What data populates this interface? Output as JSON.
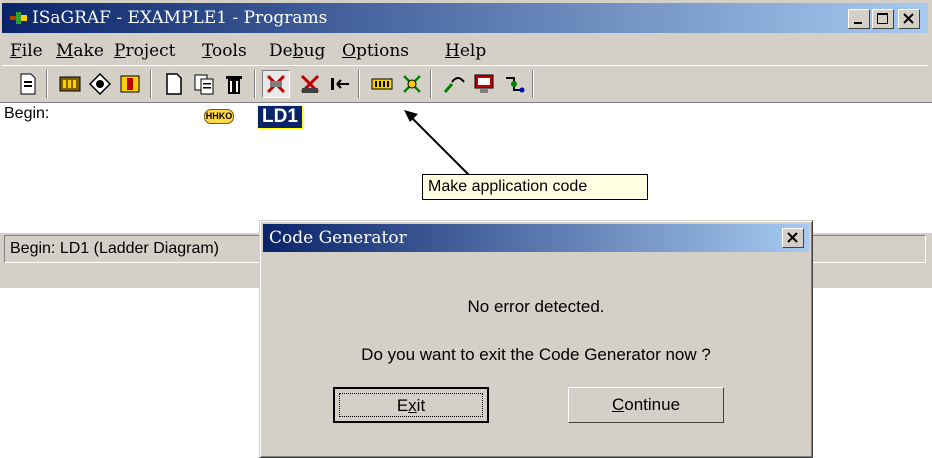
{
  "window": {
    "title": "ISaGRAF - EXAMPLE1 - Programs"
  },
  "menu": {
    "items": [
      {
        "label": "File",
        "accel": "F",
        "rest": "ile"
      },
      {
        "label": "Make",
        "accel": "M",
        "rest": "ake"
      },
      {
        "label": "Project",
        "accel": "P",
        "rest": "roject"
      },
      {
        "label": "Tools",
        "accel": "T",
        "rest": "ools"
      },
      {
        "label": "Debug",
        "pre": "De",
        "accel": "b",
        "rest": "ug"
      },
      {
        "label": "Options",
        "accel": "O",
        "rest": "ptions"
      },
      {
        "label": "Help",
        "accel": "H",
        "rest": "elp"
      }
    ]
  },
  "toolbar": {
    "icons": [
      "document-icon",
      "dictionary-icon",
      "io-connection-icon",
      "variables-icon",
      "new-program-icon",
      "copy-icon",
      "delete-icon",
      "make-application-icon",
      "verify-icon",
      "link-icon",
      "io-board-icon",
      "libraries-icon",
      "connect-icon",
      "debug-icon",
      "simulate-icon"
    ]
  },
  "program_list": {
    "section_label": "Begin:",
    "program_type_badge": "HHKO",
    "program_name": "LD1"
  },
  "tooltip": {
    "text": "Make application code"
  },
  "status_bar": {
    "text": "Begin:  LD1   (Ladder Diagram)"
  },
  "dialog": {
    "title": "Code Generator",
    "message_line1": "No error detected.",
    "message_line2": "Do you want to exit the Code Generator now ?",
    "exit_button": {
      "pre": "E",
      "accel": "x",
      "rest": "it"
    },
    "continue_button": {
      "pre": "",
      "accel": "C",
      "rest": "ontinue"
    }
  },
  "colors": {
    "titlebar_start": "#0a246a",
    "titlebar_end": "#a6caf0",
    "face": "#d4d0c8",
    "tooltip_bg": "#ffffe1"
  }
}
